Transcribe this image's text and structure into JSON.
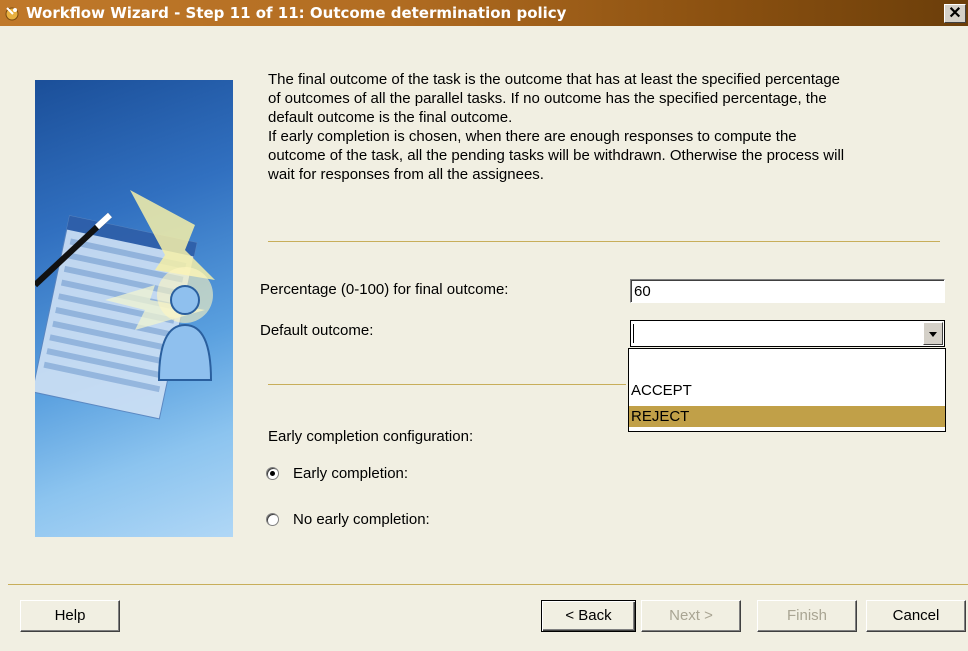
{
  "window": {
    "title": "Workflow Wizard - Step 11 of 11: Outcome determination policy",
    "close_label": "✕"
  },
  "description": {
    "lines": [
      "The final outcome of the task is the outcome that has at least the specified percentage",
      "of outcomes of all the parallel tasks. If no outcome has the specified percentage, the",
      "default outcome is the final outcome.",
      "If early completion is chosen, when there are enough responses to compute the",
      "outcome of the task, all the pending tasks will be withdrawn. Otherwise the process will",
      "wait for responses from all the assignees."
    ]
  },
  "form": {
    "percentage_label": "Percentage (0-100) for final outcome:",
    "percentage_value": "60",
    "default_outcome_label": "Default outcome:",
    "default_outcome_value": "",
    "default_outcome_options": [
      "",
      "ACCEPT",
      "REJECT"
    ],
    "highlighted_option": "REJECT"
  },
  "early_completion": {
    "heading": "Early completion configuration:",
    "options": [
      {
        "label": "Early completion:",
        "selected": true
      },
      {
        "label": "No early completion:",
        "selected": false
      }
    ]
  },
  "buttons": {
    "help": "Help",
    "back_prefix": "< ",
    "back": "Back",
    "next": "Next >",
    "finish": "Finish",
    "cancel": "Cancel"
  },
  "colors": {
    "accent": "#c1a048",
    "divider": "#c8ae5a",
    "background": "#f1efe2"
  },
  "icons": [
    "wizard-app-icon",
    "wizard-illustration",
    "dropdown-arrow-icon"
  ]
}
